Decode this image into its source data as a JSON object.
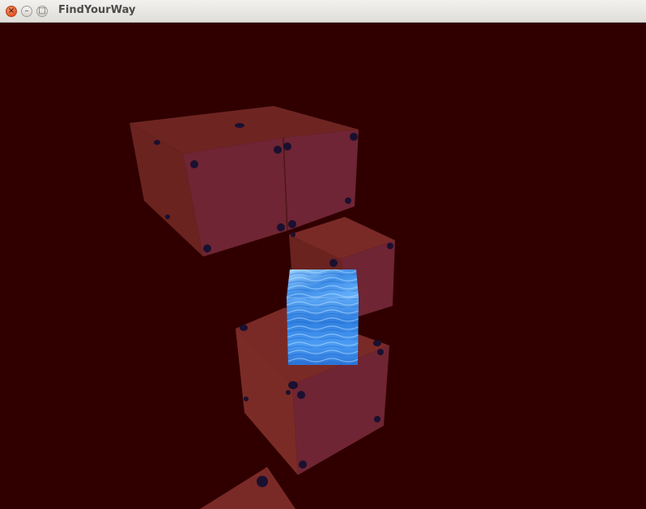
{
  "window": {
    "title": "FindYourWay",
    "close_glyph": "×",
    "minimize_glyph": "–",
    "maximize_glyph": "□"
  },
  "scene": {
    "background_color": "#300000",
    "block_color": "#7a2a26",
    "player_texture": "water",
    "block_count": 5
  }
}
